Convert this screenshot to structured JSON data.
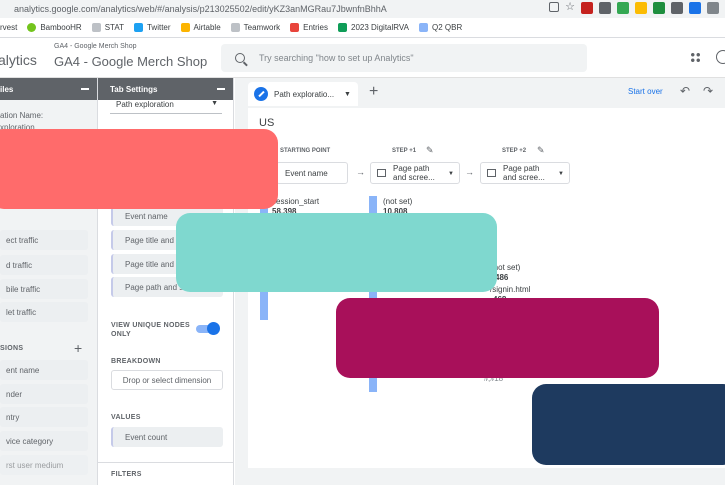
{
  "browser": {
    "url": "analytics.google.com/analytics/web/#/analysis/p213025502/edit/yKZ3anMGRau7JbwnfnBhhA",
    "bookmarks": [
      "rvest",
      "BambooHR",
      "STAT",
      "Twitter",
      "Airtable",
      "Teamwork",
      "Entries",
      "2023 DigitalRVA",
      "Q2 QBR"
    ]
  },
  "header": {
    "app_name": "alytics",
    "property_small": "GA4 - Google Merch Shop",
    "property_big": "GA4 - Google Merch Shop",
    "search_placeholder": "Try searching \"how to set up Analytics\""
  },
  "variables_panel": {
    "title": "iles",
    "name_label": "ation Name:",
    "name_value": "xploration",
    "segments": [
      "ect traffic",
      "d traffic",
      "bile traffic",
      "let traffic"
    ],
    "dimensions_label": "SIONS",
    "dimensions": [
      "ent name",
      "nder",
      "ntry",
      "vice category",
      "rst user medium"
    ]
  },
  "tab_settings": {
    "title": "Tab Settings",
    "technique": "Path exploration",
    "nodes": [
      "Event name",
      "Page title and",
      "Page title and",
      "Page path and s"
    ],
    "view_unique_label": "VIEW UNIQUE NODES ONLY",
    "breakdown_label": "BREAKDOWN",
    "breakdown_drop": "Drop or select dimension",
    "values_label": "VALUES",
    "values_item": "Event count",
    "filters_label": "FILTERS"
  },
  "main": {
    "tab_label": "Path exploratio...",
    "add_tab": "+",
    "start_over": "Start over",
    "segment_title": "US",
    "starting_point_label": "STARTING POINT",
    "step1_label": "STEP +1",
    "step2_label": "STEP +2",
    "starting_node": "Event name",
    "step1_node": "Page path and scree...",
    "step2_node": "Page path and scree...",
    "nodes": [
      {
        "name": "session_start",
        "value": "58,398"
      },
      {
        "name": "(not set)",
        "value": "10,808"
      },
      {
        "name": "(not set)",
        "value": "486"
      },
      {
        "name": "/signin.html",
        "value": "468"
      },
      {
        "name": "",
        "value": "ﾙ,ﾙ18"
      }
    ]
  },
  "colors": {
    "overlay_red": "#ff6b6b",
    "overlay_teal": "#7fd8cf",
    "overlay_magenta": "#a8105a",
    "overlay_navy": "#1e3a5f",
    "accent": "#1a73e8"
  }
}
